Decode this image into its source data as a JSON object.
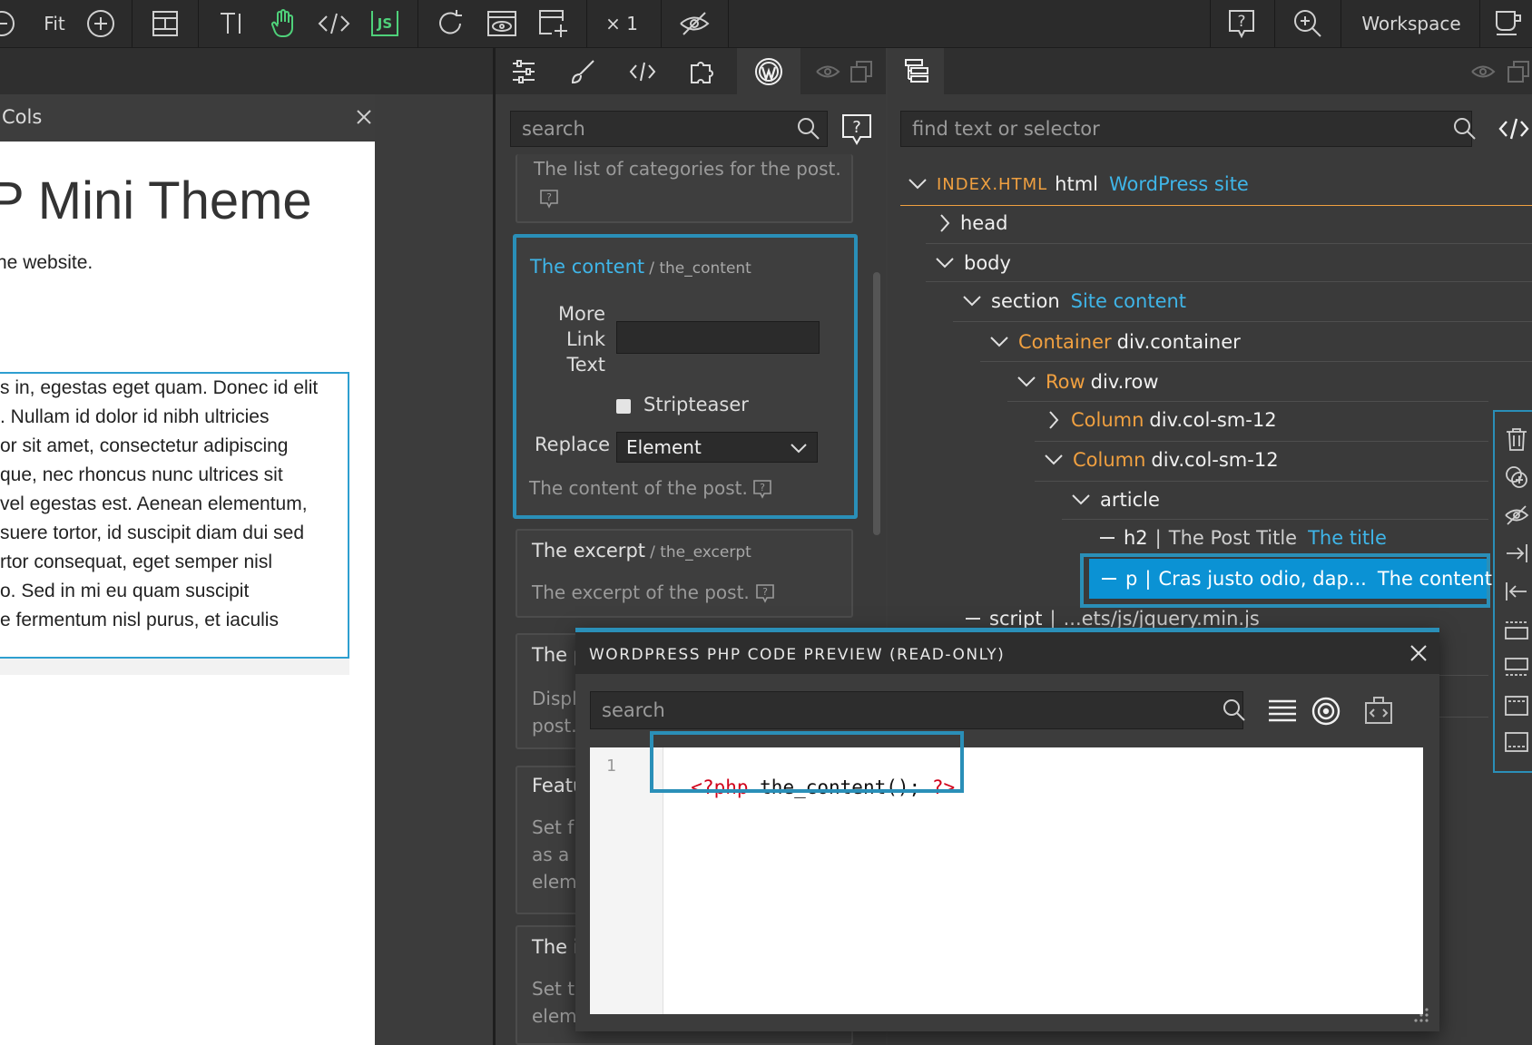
{
  "toolbar": {
    "fit_label": "Fit",
    "multiplier": "× 1",
    "workspace_label": "Workspace"
  },
  "canvas": {
    "panel_label": "Cols",
    "doc_title": "P Mini Theme",
    "doc_subtitle": "he website.",
    "paragraph_lines": [
      "s in, egestas eget quam. Donec id elit",
      ". Nullam id dolor id nibh ultricies",
      "or sit amet, consectetur adipiscing",
      "que, nec rhoncus nunc ultrices sit",
      "vel egestas est. Aenean elementum,",
      "suere tortor, id suscipit diam dui sed",
      "rtor consequat, eget semper nisl",
      "o. Sed in mi eu quam suscipit",
      "e fermentum nisl purus, et iaculis"
    ]
  },
  "properties": {
    "search_placeholder": "search",
    "categories_desc": "The list of categories for the post.",
    "content_card": {
      "title": "The content",
      "sub": "/ the_content",
      "more_link_label_1": "More",
      "more_link_label_2": "Link",
      "more_link_label_3": "Text",
      "more_link_value": "",
      "stripteaser_label": "Stripteaser",
      "replace_label": "Replace",
      "replace_value": "Element",
      "desc": "The content of the post."
    },
    "excerpt_card": {
      "title": "The excerpt",
      "sub": "/ the_excerpt",
      "desc": "The excerpt of the post."
    },
    "cut_cards": {
      "c1_title": "The p",
      "c1_line1": "Displ",
      "c1_line2": "post.",
      "c2_title": "Featu",
      "c2_line1": "Set f",
      "c2_line2": "as a",
      "c2_line3": "elem",
      "c3_title": "The i",
      "c3_line1": "Set t",
      "c3_line2": "elem"
    }
  },
  "tree": {
    "search_placeholder": "find text or selector",
    "root": {
      "file": "INDEX.HTML",
      "tag": "html",
      "name": "WordPress site"
    },
    "head": "head",
    "body": "body",
    "section": {
      "tag": "section",
      "name": "Site content"
    },
    "container": {
      "name": "Container",
      "tag": "div.container"
    },
    "row": {
      "name": "Row",
      "tag": "div.row"
    },
    "col1": {
      "name": "Column",
      "tag": "div.col-sm-12"
    },
    "col2": {
      "name": "Column",
      "tag": "div.col-sm-12"
    },
    "article": "article",
    "h2": {
      "tag": "h2",
      "sep": "|",
      "text": "The Post Title",
      "name": "The title"
    },
    "p": {
      "tag": "p",
      "sep": "|",
      "text": "Cras justo odio, dap...",
      "name": "The content"
    },
    "script": {
      "tag": "script",
      "sep": "|",
      "text": "...ets/js/jquery.min.js"
    }
  },
  "modal": {
    "title": "WORDPRESS PHP CODE PREVIEW (READ-ONLY)",
    "search_placeholder": "search",
    "line_number": "1",
    "code_open": "<?php",
    "code_body": " the_content(); ",
    "code_close": "?>"
  },
  "colors": {
    "accent_blue": "#2a8fb8",
    "selector_orange": "#f0a040",
    "name_blue": "#3fb5e8",
    "php_red": "#d0021b",
    "green_icon": "#4fd17a"
  },
  "icons": [
    "minus-circle-icon",
    "plus-circle-icon",
    "layout-icon",
    "text-icon",
    "hand-icon",
    "code-icon",
    "js-icon",
    "refresh-icon",
    "preview-icon",
    "add-page-icon",
    "eye-off-icon",
    "help-icon",
    "zoom-icon",
    "cup-icon",
    "sliders-icon",
    "brush-icon",
    "puzzle-icon",
    "wordpress-icon",
    "tree-icon",
    "trash-icon"
  ]
}
